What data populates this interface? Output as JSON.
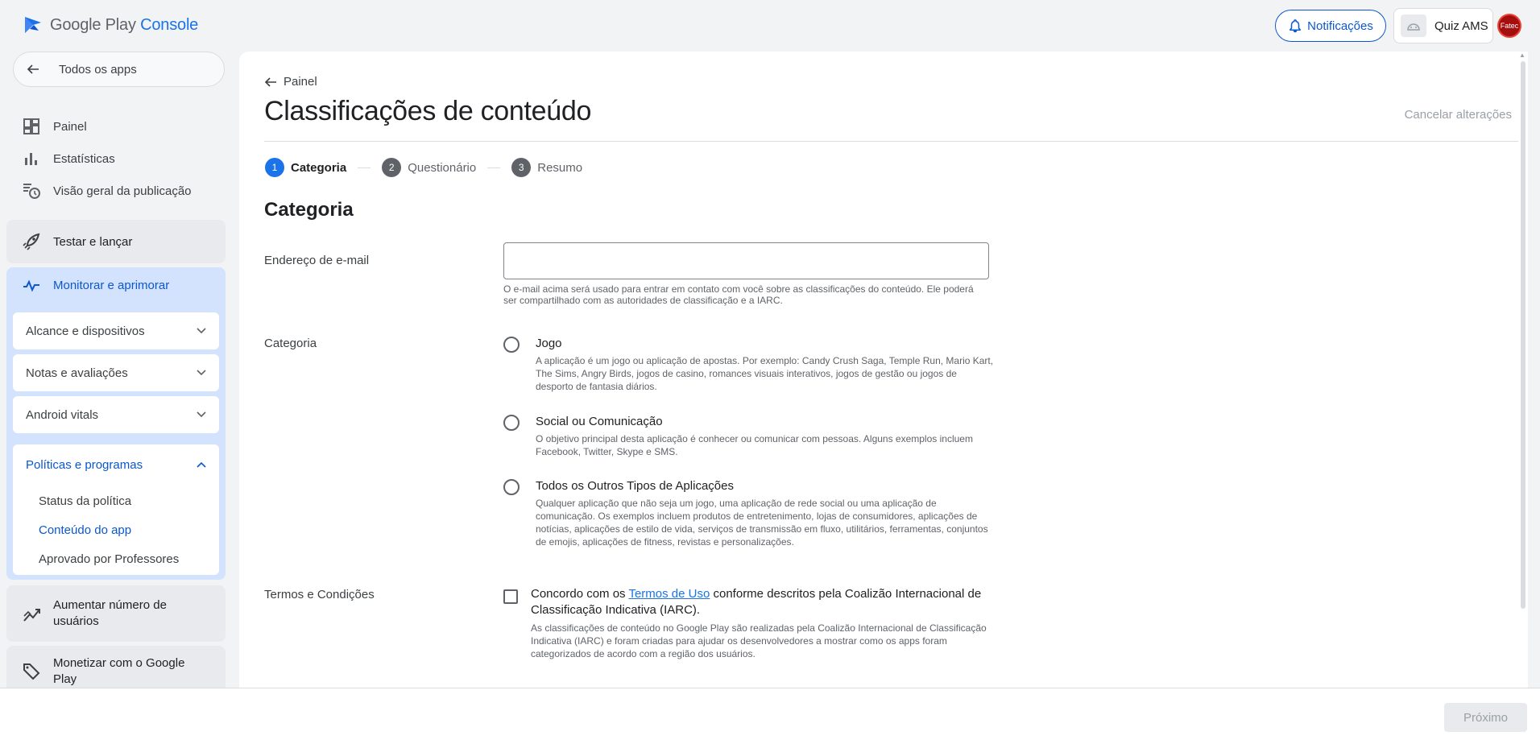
{
  "header": {
    "logo_brand": "Google Play",
    "logo_product": "Console",
    "notifications_label": "Notificações",
    "app_name": "Quiz AMS",
    "avatar_text": "Fatec"
  },
  "sidebar": {
    "all_apps_label": "Todos os apps",
    "items": [
      {
        "label": "Painel",
        "icon": "dashboard-icon"
      },
      {
        "label": "Estatísticas",
        "icon": "bar-chart-icon"
      },
      {
        "label": "Visão geral da publicação",
        "icon": "publishing-overview-icon"
      }
    ],
    "test_release": "Testar e lançar",
    "monitor": {
      "label": "Monitorar e aprimorar",
      "subgroups": [
        {
          "label": "Alcance e dispositivos"
        },
        {
          "label": "Notas e avaliações"
        },
        {
          "label": "Android vitals"
        },
        {
          "label": "Políticas e programas"
        }
      ],
      "policy_links": [
        {
          "label": "Status da política"
        },
        {
          "label": "Conteúdo do app"
        },
        {
          "label": "Aprovado por Professores"
        }
      ]
    },
    "grow_users": "Aumentar número de usuários",
    "monetize": "Monetizar com o Google Play"
  },
  "main": {
    "back_label": "Painel",
    "title": "Classificações de conteúdo",
    "cancel_label": "Cancelar alterações",
    "steps": [
      {
        "num": "1",
        "label": "Categoria"
      },
      {
        "num": "2",
        "label": "Questionário"
      },
      {
        "num": "3",
        "label": "Resumo"
      }
    ],
    "section_title": "Categoria",
    "email": {
      "label": "Endereço de e-mail",
      "value": "",
      "helper": "O e-mail acima será usado para entrar em contato com você sobre as classificações do conteúdo. Ele poderá ser compartilhado com as autoridades de classificação e a IARC."
    },
    "category": {
      "label": "Categoria",
      "options": [
        {
          "title": "Jogo",
          "desc": "A aplicação é um jogo ou aplicação de apostas. Por exemplo: Candy Crush Saga, Temple Run, Mario Kart, The Sims, Angry Birds, jogos de casino, romances visuais interativos, jogos de gestão ou jogos de desporto de fantasia diários."
        },
        {
          "title": "Social ou Comunicação",
          "desc": "O objetivo principal desta aplicação é conhecer ou comunicar com pessoas. Alguns exemplos incluem Facebook, Twitter, Skype e SMS."
        },
        {
          "title": "Todos os Outros Tipos de Aplicações",
          "desc": "Qualquer aplicação que não seja um jogo, uma aplicação de rede social ou uma aplicação de comunicação. Os exemplos incluem produtos de entretenimento, lojas de consumidores, aplicações de notícias, aplicações de estilo de vida, serviços de transmissão em fluxo, utilitários, ferramentas, conjuntos de emojis, aplicações de fitness, revistas e personalizações."
        }
      ]
    },
    "terms": {
      "label": "Termos e Condições",
      "text_before": "Concordo com os ",
      "link_text": "Termos de Uso",
      "text_after": " conforme descritos pela Coalizão Internacional de Classificação Indicativa (IARC).",
      "desc": "As classificações de conteúdo no Google Play são realizadas pela Coalizão Internacional de Classificação Indicativa (IARC) e foram criadas para ajudar os desenvolvedores a mostrar como os apps foram categorizados de acordo com a região dos usuários."
    }
  },
  "footer": {
    "next_label": "Próximo"
  },
  "colors": {
    "accent": "#1a73e8",
    "active_nav_bg": "#d3e3fd",
    "avatar_bg": "#a50e0e"
  }
}
